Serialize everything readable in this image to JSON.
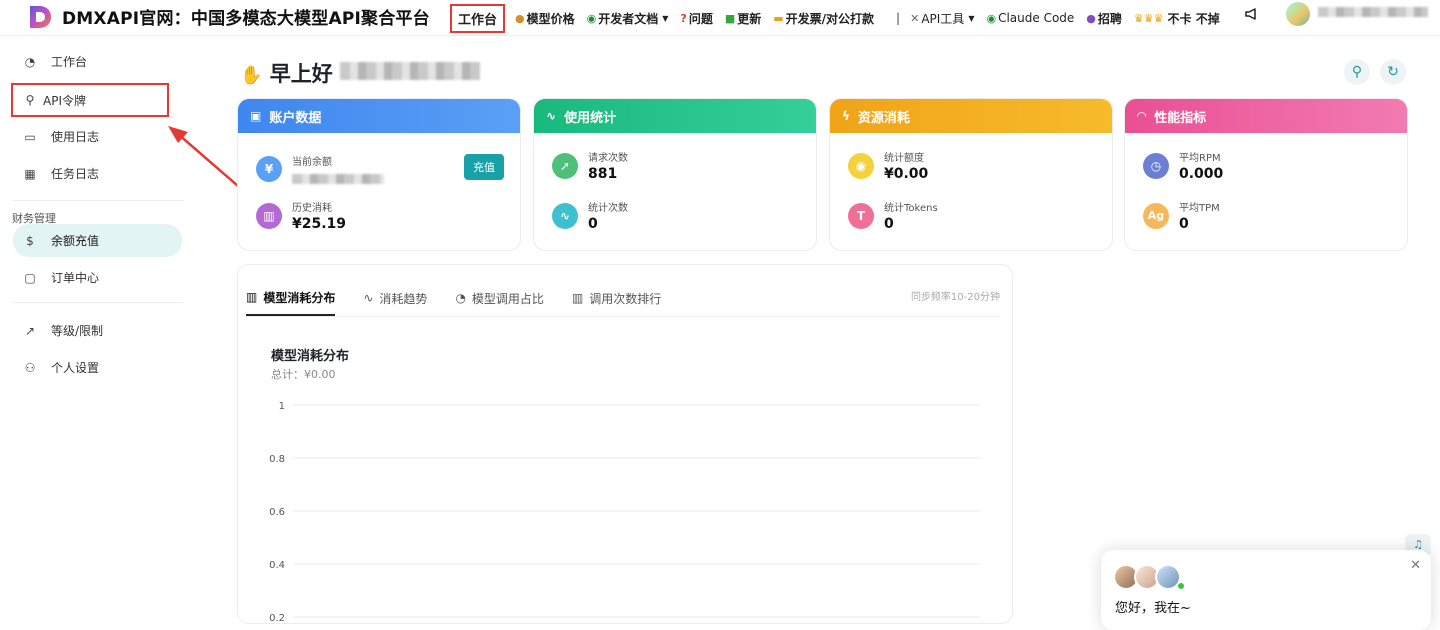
{
  "brand": {
    "title": "DMXAPI官网：中国多模态大模型API聚合平台"
  },
  "nav": {
    "workbench": "工作台",
    "model_price": "模型价格",
    "dev_docs": "开发者文档",
    "issues": "问题",
    "updates": "更新",
    "invoice": "开发票/对公打款",
    "separator": "|",
    "api_tools": "API工具",
    "claude_code": "Claude Code",
    "hiring": "招聘",
    "no_lag": "不卡 不掉"
  },
  "sidebar": {
    "items": [
      {
        "label": "工作台",
        "icon": "dashboard-icon"
      },
      {
        "label": "API令牌",
        "icon": "key-icon"
      },
      {
        "label": "使用日志",
        "icon": "log-icon"
      },
      {
        "label": "任务日志",
        "icon": "task-icon"
      }
    ],
    "finance_group": "财务管理",
    "finance_items": [
      {
        "label": "余额充值",
        "icon": "dollar-icon"
      },
      {
        "label": "订单中心",
        "icon": "order-icon"
      }
    ],
    "other_items": [
      {
        "label": "等级/限制",
        "icon": "trend-icon"
      },
      {
        "label": "个人设置",
        "icon": "user-icon"
      }
    ]
  },
  "greeting": {
    "text": "早上好"
  },
  "cards": {
    "account": {
      "title": "账户数据",
      "balance_label": "当前余额",
      "recharge": "充值",
      "history_label": "历史消耗",
      "history_value": "¥25.19",
      "color": "#4a8ff0"
    },
    "usage": {
      "title": "使用统计",
      "requests_label": "请求次数",
      "requests_value": "881",
      "stat_count_label": "统计次数",
      "stat_count_value": "0",
      "color": "#1fbf8a"
    },
    "resource": {
      "title": "资源消耗",
      "quota_label": "统计额度",
      "quota_value": "¥0.00",
      "tokens_label": "统计Tokens",
      "tokens_value": "0",
      "color": "#f2a91c"
    },
    "performance": {
      "title": "性能指标",
      "rpm_label": "平均RPM",
      "rpm_value": "0.000",
      "tpm_label": "平均TPM",
      "tpm_value": "0",
      "tpm_badge": "Ag",
      "color": "#ef5b9c"
    }
  },
  "panel": {
    "tabs": [
      "模型消耗分布",
      "消耗趋势",
      "模型调用占比",
      "调用次数排行"
    ],
    "sync": "同步频率10-20分钟"
  },
  "chart_data": {
    "type": "bar",
    "title": "模型消耗分布",
    "subtitle": "总计：¥0.00",
    "categories": [],
    "values": [],
    "yticks": [
      "1",
      "0.8",
      "0.6",
      "0.4",
      "0.2"
    ],
    "ylim": [
      0,
      1
    ],
    "grid": true
  },
  "chat": {
    "message": "您好，我在~"
  }
}
